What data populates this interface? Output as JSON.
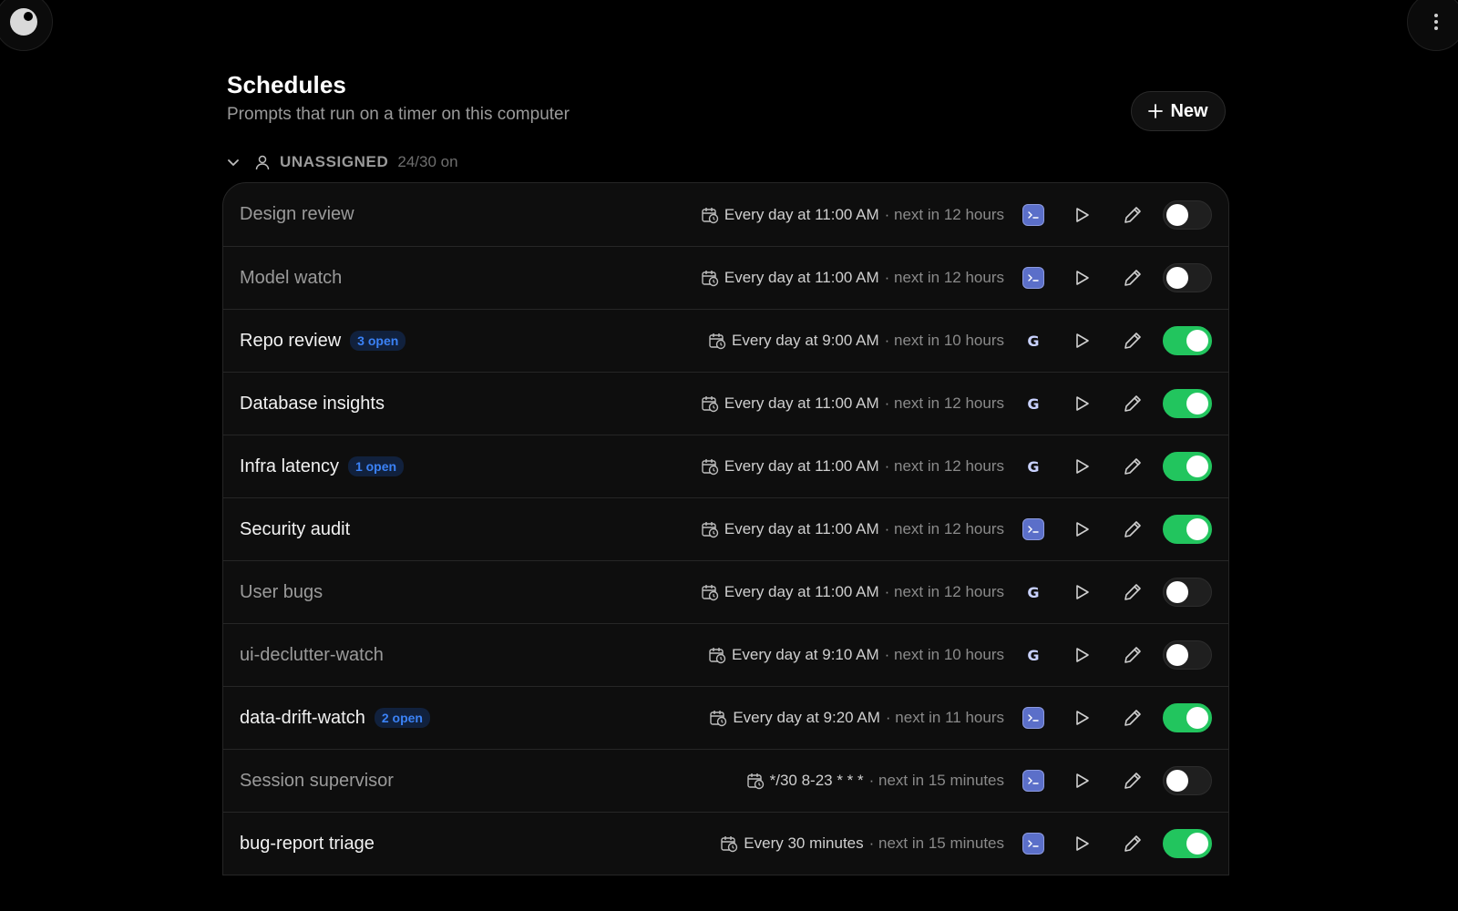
{
  "header": {
    "title": "Schedules",
    "subtitle": "Prompts that run on a timer on this computer",
    "new_label": "New"
  },
  "group": {
    "label": "UNASSIGNED",
    "count": "24/30 on"
  },
  "colors": {
    "toggle_on": "#22c55e",
    "badge": "#3b82f6",
    "background": "#000000"
  },
  "rows": [
    {
      "name": "Design review",
      "badge": "",
      "schedule": "Every day at 11:00 AM",
      "next": "· next in 12 hours",
      "agent": "terminal-icon",
      "enabled": false
    },
    {
      "name": "Model watch",
      "badge": "",
      "schedule": "Every day at 11:00 AM",
      "next": "· next in 12 hours",
      "agent": "terminal-icon",
      "enabled": false
    },
    {
      "name": "Repo review",
      "badge": "3 open",
      "schedule": "Every day at 9:00 AM",
      "next": "· next in 10 hours",
      "agent": "g-icon",
      "enabled": true
    },
    {
      "name": "Database insights",
      "badge": "",
      "schedule": "Every day at 11:00 AM",
      "next": "· next in 12 hours",
      "agent": "g-icon",
      "enabled": true
    },
    {
      "name": "Infra latency",
      "badge": "1 open",
      "schedule": "Every day at 11:00 AM",
      "next": "· next in 12 hours",
      "agent": "g-icon",
      "enabled": true
    },
    {
      "name": "Security audit",
      "badge": "",
      "schedule": "Every day at 11:00 AM",
      "next": "· next in 12 hours",
      "agent": "terminal-icon",
      "enabled": true
    },
    {
      "name": "User bugs",
      "badge": "",
      "schedule": "Every day at 11:00 AM",
      "next": "· next in 12 hours",
      "agent": "g-icon",
      "enabled": false
    },
    {
      "name": "ui-declutter-watch",
      "badge": "",
      "schedule": "Every day at 9:10 AM",
      "next": "· next in 10 hours",
      "agent": "g-icon",
      "enabled": false
    },
    {
      "name": "data-drift-watch",
      "badge": "2 open",
      "schedule": "Every day at 9:20 AM",
      "next": "· next in 11 hours",
      "agent": "terminal-icon",
      "enabled": true
    },
    {
      "name": "Session supervisor",
      "badge": "",
      "schedule": "*/30 8-23 * * *",
      "next": "· next in 15 minutes",
      "agent": "terminal-icon",
      "enabled": false
    },
    {
      "name": "bug-report triage",
      "badge": "",
      "schedule": "Every 30 minutes",
      "next": "· next in 15 minutes",
      "agent": "terminal-icon",
      "enabled": true
    }
  ]
}
